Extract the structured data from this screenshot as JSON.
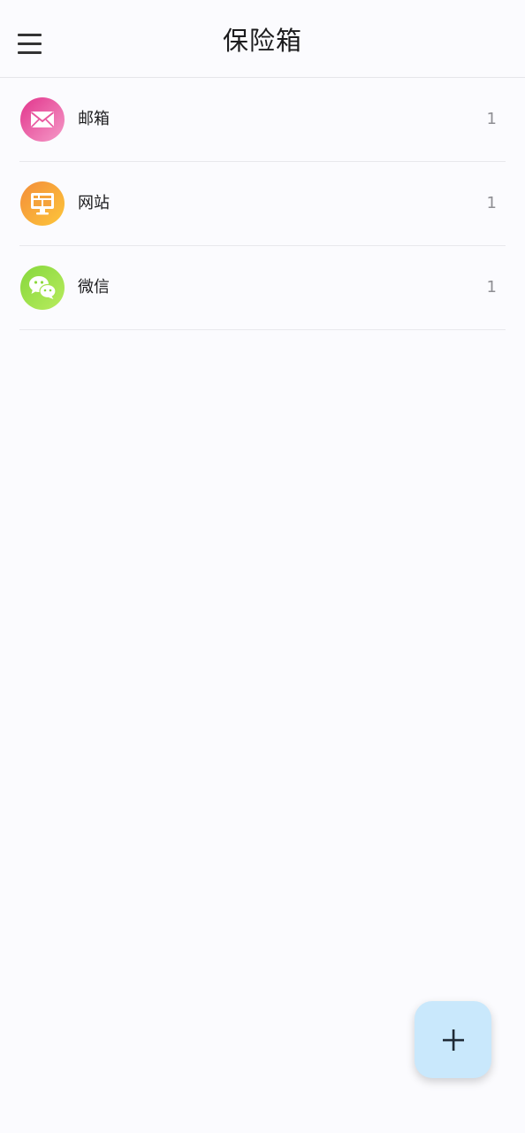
{
  "header": {
    "title": "保险箱",
    "menu_icon": "hamburger-menu-icon"
  },
  "categories": [
    {
      "label": "邮箱",
      "count": "1",
      "icon": "mail-icon",
      "colors": [
        "#e9358e",
        "#f08dc1"
      ]
    },
    {
      "label": "网站",
      "count": "1",
      "icon": "monitor-icon",
      "colors": [
        "#f59a3b",
        "#fcc339"
      ]
    },
    {
      "label": "微信",
      "count": "1",
      "icon": "wechat-icon",
      "colors": [
        "#8dd93e",
        "#b3ea5a"
      ]
    }
  ],
  "fab": {
    "icon": "plus-icon",
    "color": "#c9e8fc"
  },
  "colors": {
    "background": "#fbfbfe",
    "divider": "#e8e8ec",
    "count_text": "#8e8e93"
  }
}
